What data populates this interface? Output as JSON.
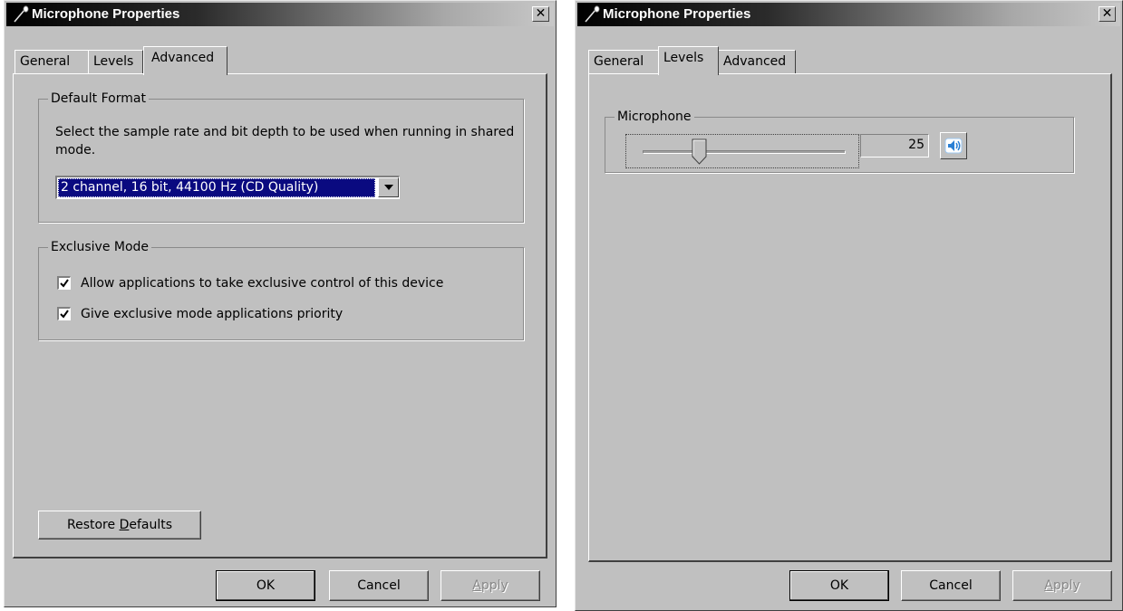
{
  "dialog_advanced": {
    "title": "Microphone Properties",
    "close_glyph": "✕",
    "tabs": [
      {
        "label": "General",
        "active": false
      },
      {
        "label": "Levels",
        "active": false
      },
      {
        "label": "Advanced",
        "active": true
      }
    ],
    "default_format": {
      "title": "Default Format",
      "description": "Select the sample rate and bit depth to be used when running in shared mode.",
      "selected_format": "2 channel, 16 bit, 44100 Hz (CD Quality)"
    },
    "exclusive_mode": {
      "title": "Exclusive Mode",
      "options": [
        {
          "label": "Allow applications to take exclusive control of this device",
          "checked": true
        },
        {
          "label": "Give exclusive mode applications priority",
          "checked": true
        }
      ]
    },
    "restore_defaults": {
      "prefix": "Restore ",
      "mnemonic": "D",
      "suffix": "efaults"
    },
    "buttons": {
      "ok": "OK",
      "cancel": "Cancel",
      "apply_mnemonic": "A",
      "apply_rest": "pply"
    }
  },
  "dialog_levels": {
    "title": "Microphone Properties",
    "close_glyph": "✕",
    "tabs": [
      {
        "label": "General",
        "active": false
      },
      {
        "label": "Levels",
        "active": true
      },
      {
        "label": "Advanced",
        "active": false
      }
    ],
    "microphone": {
      "title": "Microphone",
      "level_value": "25",
      "level_fraction": 0.25,
      "mute_icon": "speaker-icon"
    },
    "buttons": {
      "ok": "OK",
      "cancel": "Cancel",
      "apply_mnemonic": "A",
      "apply_rest": "pply"
    }
  },
  "colors": {
    "face": "#c0c0c0",
    "selection": "#0a0a80",
    "title_start": "#000000",
    "title_end": "#c8c8c8",
    "speaker_blue": "#2a7fd4"
  }
}
